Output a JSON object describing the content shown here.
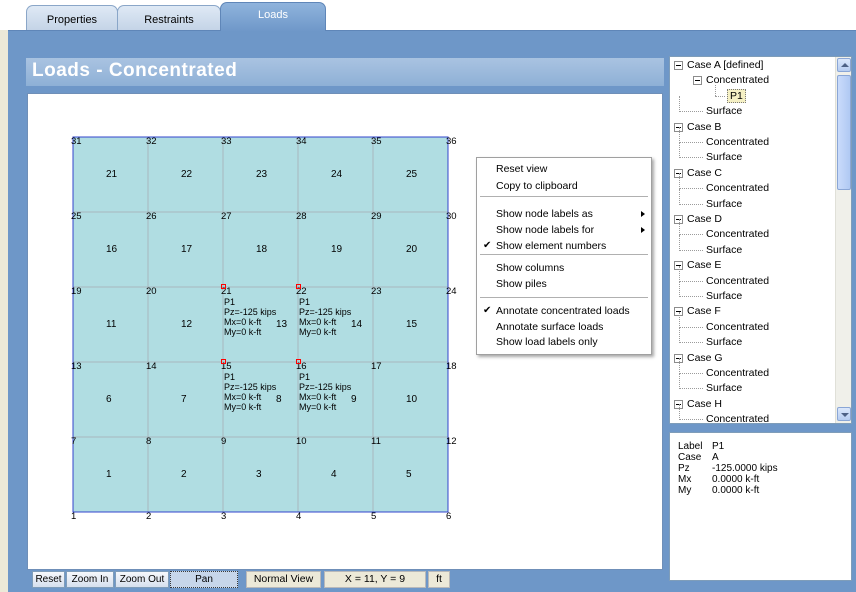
{
  "tabs": [
    {
      "label": "Properties",
      "active": false
    },
    {
      "label": "Restraints",
      "active": false
    },
    {
      "label": "Loads",
      "active": true
    }
  ],
  "panel_title": "Loads - Concentrated",
  "colors": {
    "slab_fill": "#b0dde2",
    "slab_border": "#3344cc",
    "grid_line": "#a8b8be",
    "load_marker": "#ff0000",
    "frame": "#6e97c8"
  },
  "grid": {
    "node_rows": [
      [
        "31",
        "32",
        "33",
        "34",
        "35",
        "36"
      ],
      [
        "25",
        "26",
        "27",
        "28",
        "29",
        "30"
      ],
      [
        "19",
        "20",
        "21",
        "22",
        "23",
        "24"
      ],
      [
        "13",
        "14",
        "15",
        "16",
        "17",
        "18"
      ],
      [
        "7",
        "8",
        "9",
        "10",
        "11",
        "12"
      ],
      [
        "1",
        "2",
        "3",
        "4",
        "5",
        "6"
      ]
    ],
    "element_rows": [
      [
        "21",
        "22",
        "23",
        "24",
        "25"
      ],
      [
        "16",
        "17",
        "18",
        "19",
        "20"
      ],
      [
        "11",
        "12",
        "13",
        "14",
        "15"
      ],
      [
        "6",
        "7",
        "8",
        "9",
        "10"
      ],
      [
        "1",
        "2",
        "3",
        "4",
        "5"
      ]
    ]
  },
  "loads": [
    {
      "label": "P1",
      "pz": "Pz=-125 kips",
      "mx": "Mx=0 k-ft",
      "my": "My=0 k-ft"
    },
    {
      "label": "P1",
      "pz": "Pz=-125 kips",
      "mx": "Mx=0 k-ft",
      "my": "My=0 k-ft"
    },
    {
      "label": "P1",
      "pz": "Pz=-125 kips",
      "mx": "Mx=0 k-ft",
      "my": "My=0 k-ft"
    },
    {
      "label": "P1",
      "pz": "Pz=-125 kips",
      "mx": "Mx=0 k-ft",
      "my": "My=0 k-ft"
    }
  ],
  "context_menu": {
    "items": [
      {
        "label": "Reset view"
      },
      {
        "label": "Copy to clipboard"
      },
      {
        "label": "Show node labels as",
        "submenu": true
      },
      {
        "label": "Show node labels for",
        "submenu": true
      },
      {
        "label": "Show element numbers",
        "checked": true
      },
      {
        "label": "Show columns"
      },
      {
        "label": "Show piles"
      },
      {
        "label": "Annotate concentrated loads",
        "checked": true
      },
      {
        "label": "Annotate surface loads"
      },
      {
        "label": "Show load labels only"
      }
    ]
  },
  "toolbar": {
    "reset": "Reset",
    "zoom_in": "Zoom In",
    "zoom_out": "Zoom Out",
    "pan": "Pan",
    "view_mode": "Normal View",
    "coords": "X = 11, Y = 9",
    "units": "ft"
  },
  "tree": {
    "cases": [
      {
        "label": "Case A [defined]",
        "children": [
          {
            "label": "Concentrated",
            "children": [
              {
                "label": "P1",
                "selected": true
              }
            ]
          },
          {
            "label": "Surface"
          }
        ]
      },
      {
        "label": "Case B",
        "children": [
          {
            "label": "Concentrated"
          },
          {
            "label": "Surface"
          }
        ]
      },
      {
        "label": "Case C",
        "children": [
          {
            "label": "Concentrated"
          },
          {
            "label": "Surface"
          }
        ]
      },
      {
        "label": "Case D",
        "children": [
          {
            "label": "Concentrated"
          },
          {
            "label": "Surface"
          }
        ]
      },
      {
        "label": "Case E",
        "children": [
          {
            "label": "Concentrated"
          },
          {
            "label": "Surface"
          }
        ]
      },
      {
        "label": "Case F",
        "children": [
          {
            "label": "Concentrated"
          },
          {
            "label": "Surface"
          }
        ]
      },
      {
        "label": "Case G",
        "children": [
          {
            "label": "Concentrated"
          },
          {
            "label": "Surface"
          }
        ]
      },
      {
        "label": "Case H",
        "children": [
          {
            "label": "Concentrated"
          }
        ]
      }
    ]
  },
  "properties": [
    {
      "key": "Label",
      "value": "P1"
    },
    {
      "key": "Case",
      "value": "A"
    },
    {
      "key": "Pz",
      "value": "-125.0000 kips"
    },
    {
      "key": "Mx",
      "value": "0.0000 k-ft"
    },
    {
      "key": "My",
      "value": "0.0000 k-ft"
    }
  ]
}
